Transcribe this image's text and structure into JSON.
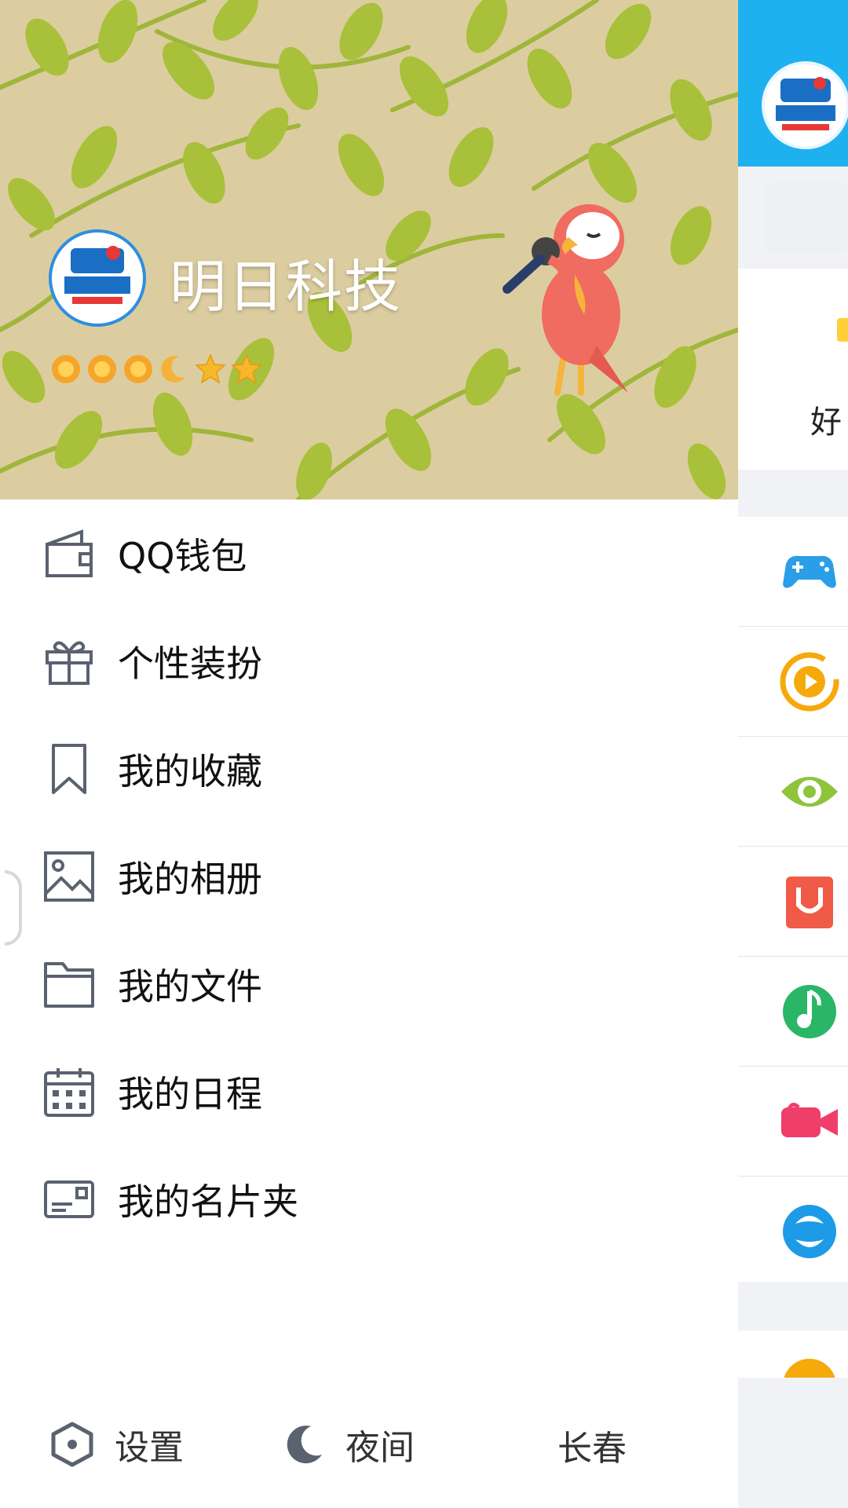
{
  "profile": {
    "name": "明日科技",
    "level_badges": [
      "sun",
      "sun",
      "sun",
      "moon",
      "star",
      "star"
    ]
  },
  "menu": {
    "items": [
      {
        "label": "QQ钱包",
        "icon": "wallet-icon"
      },
      {
        "label": "个性装扮",
        "icon": "gift-icon"
      },
      {
        "label": "我的收藏",
        "icon": "bookmark-icon"
      },
      {
        "label": "我的相册",
        "icon": "photo-album-icon"
      },
      {
        "label": "我的文件",
        "icon": "folder-icon"
      },
      {
        "label": "我的日程",
        "icon": "calendar-icon"
      },
      {
        "label": "我的名片夹",
        "icon": "card-holder-icon"
      }
    ]
  },
  "bottom_bar": {
    "settings_label": "设置",
    "night_label": "夜间",
    "city": "长春"
  },
  "background_app": {
    "partial_text": "好"
  },
  "colors": {
    "header_blue": "#1eb1f0",
    "banner_bg": "#dccda0",
    "leaf_green": "#a6be3a",
    "icon_stroke": "#5a6270"
  }
}
